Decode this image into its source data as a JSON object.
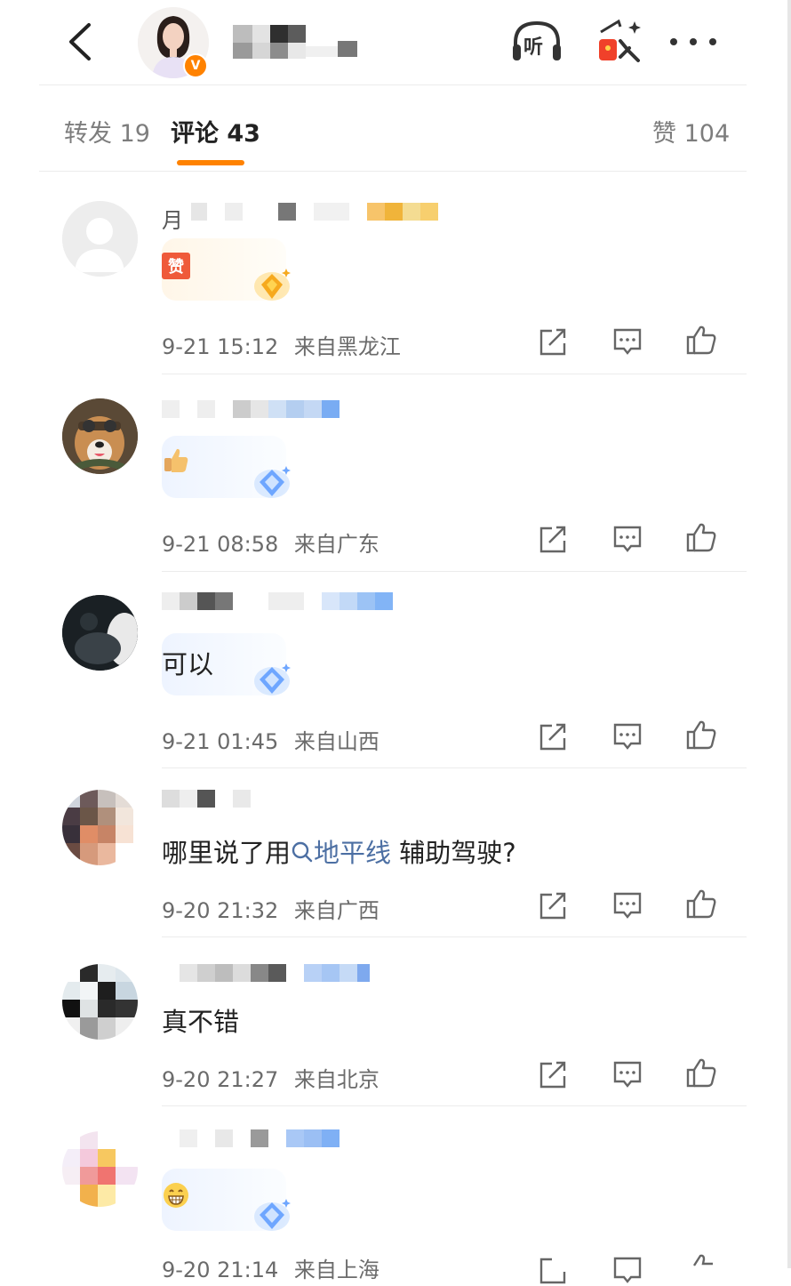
{
  "header": {
    "back_icon": "chevron-left-icon",
    "listen_label": "听",
    "verified_mark": "V",
    "more_icon": "more-dots-icon"
  },
  "tabs": [
    {
      "label": "转发 19"
    },
    {
      "label": "评论 43",
      "active": true
    },
    {
      "label": "赞 104"
    }
  ],
  "colors": {
    "accent": "#ff8200",
    "topic_link": "#4c6fa3",
    "meta_text": "#6b6b6b"
  },
  "comments": [
    {
      "name_fragment": "月",
      "body": "",
      "sticker": "赞",
      "badge": "gold-crown",
      "time": "9-21 15:12",
      "location": "来自黑龙江"
    },
    {
      "body": "",
      "sticker": "thumbs-up-emoji",
      "badge": "blue-diamond",
      "time": "9-21 08:58",
      "location": "来自广东"
    },
    {
      "body": "可以",
      "badge": "blue-diamond",
      "time": "9-21 01:45",
      "location": "来自山西"
    },
    {
      "body_prefix": "哪里说了用",
      "topic": "地平线",
      "body_suffix": " 辅助驾驶?",
      "time": "9-20 21:32",
      "location": "来自广西"
    },
    {
      "body": "真不错",
      "time": "9-20 21:27",
      "location": "来自北京"
    },
    {
      "body": "",
      "sticker": "grin-emoji",
      "badge": "blue-diamond",
      "time": "9-20 21:14",
      "location": "来自上海"
    }
  ],
  "actions": {
    "share_icon": "share-icon",
    "comment_icon": "comment-icon",
    "like_icon": "thumbs-up-icon"
  }
}
